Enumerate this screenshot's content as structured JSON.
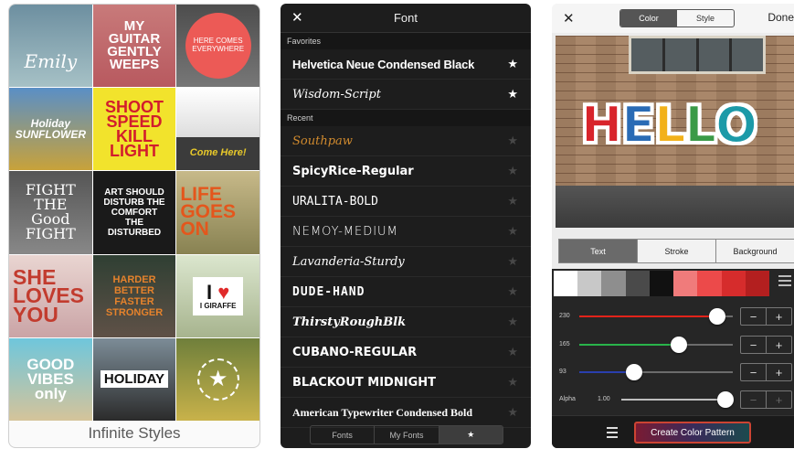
{
  "gallery": {
    "caption": "Infinite Styles",
    "tiles": [
      {
        "text": "Emily"
      },
      {
        "text": "MY GUITAR GENTLY WEEPS"
      },
      {
        "text": "HERE COMES EVERYWHERE"
      },
      {
        "text": "Holiday SUNFLOWER"
      },
      {
        "text": "SHOOT SPEED KILL LIGHT"
      },
      {
        "text": "Come Here!"
      },
      {
        "text": "FIGHT THE Good FIGHT"
      },
      {
        "text": "ART SHOULD DISTURB THE COMFORT THE DISTURBED"
      },
      {
        "text": "LIFE GOES ON"
      },
      {
        "text": "SHE LOVES YOU"
      },
      {
        "text": "HARDER BETTER FASTER STRONGER"
      },
      {
        "text": "I GIRAFFE"
      },
      {
        "text": "GOOD VIBES only"
      },
      {
        "text": "HOLIDAY"
      },
      {
        "text": ""
      }
    ]
  },
  "font_panel": {
    "close": "✕",
    "title": "Font",
    "favorites_label": "Favorites",
    "recent_label": "Recent",
    "favorites": [
      {
        "name": "Helvetica Neue Condensed Black",
        "starred": true
      },
      {
        "name": "Wisdom-Script",
        "starred": true
      }
    ],
    "recent": [
      {
        "name": "Southpaw",
        "starred": false
      },
      {
        "name": "SpicyRice-Regular",
        "starred": false
      },
      {
        "name": "URALITA-BOLD",
        "starred": false
      },
      {
        "name": "NEMOY-MEDIUM",
        "starred": false
      },
      {
        "name": "Lavanderia-Sturdy",
        "starred": false
      },
      {
        "name": "DUDE-HAND",
        "starred": false
      },
      {
        "name": "ThirstyRoughBlk",
        "starred": false
      },
      {
        "name": "CUBANO-REGULAR",
        "starred": false
      },
      {
        "name": "BLACKOUT MIDNIGHT",
        "starred": false
      },
      {
        "name": "American Typewriter Condensed Bold",
        "starred": false
      }
    ],
    "tabs": [
      "Fonts",
      "My Fonts",
      "★"
    ]
  },
  "color_panel": {
    "close": "✕",
    "seg": [
      "Color",
      "Style"
    ],
    "done": "Done",
    "preview_text": "HELLO",
    "preview_letter_colors": [
      "#d8242b",
      "#2a6bb5",
      "#f2b11a",
      "#3a9a47",
      "#1c9aa8"
    ],
    "tabs": [
      "Text",
      "Stroke",
      "Background"
    ],
    "swatches": [
      "#ffffff",
      "#c8c8c8",
      "#8e8e8e",
      "#4a4a4a",
      "#111111",
      "#f07b7b",
      "#ec4a4a",
      "#d62c2c",
      "#b31f1f"
    ],
    "sliders": [
      {
        "label": "230",
        "value": 0.9,
        "color": "#e2231a"
      },
      {
        "label": "165",
        "value": 0.65,
        "color": "#29b34a"
      },
      {
        "label": "93",
        "value": 0.36,
        "color": "#2a3fae"
      },
      {
        "label": "Alpha",
        "value_text": "1.00",
        "value": 1.0,
        "color": "#bdbdbd"
      }
    ],
    "stepper_minus": "−",
    "stepper_plus": "+",
    "create_button": "Create Color Pattern"
  }
}
